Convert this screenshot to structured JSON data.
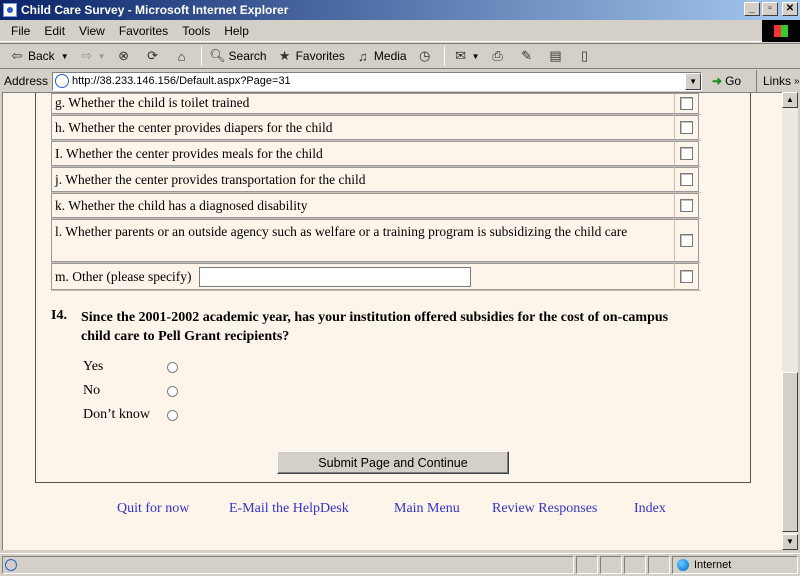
{
  "window": {
    "title": "Child Care Survey - Microsoft Internet Explorer",
    "minimize": "_",
    "maximize": "▫",
    "close": "✕"
  },
  "menu": [
    "File",
    "Edit",
    "View",
    "Favorites",
    "Tools",
    "Help"
  ],
  "toolbar": {
    "back": "Back",
    "search": "Search",
    "favorites": "Favorites",
    "media": "Media"
  },
  "address": {
    "label": "Address",
    "url": "http://38.233.146.156/Default.aspx?Page=31",
    "go": "Go",
    "links": "Links"
  },
  "options": [
    {
      "text": "g.  Whether the child is toilet trained",
      "checked": false
    },
    {
      "text": "h.  Whether the center provides diapers for the child",
      "checked": false
    },
    {
      "text": "I.  Whether the center provides meals for the child",
      "checked": false
    },
    {
      "text": "j.  Whether the center provides transportation for the child",
      "checked": false
    },
    {
      "text": "k.  Whether the child has a diagnosed disability",
      "checked": false
    },
    {
      "text": "l.  Whether parents or an outside agency such as welfare or a training program is subsidizing the child care",
      "checked": false
    },
    {
      "text": "m.  Other (please specify)",
      "checked": false,
      "specify_value": ""
    }
  ],
  "question": {
    "number": "I4.",
    "text": "Since the 2001-2002 academic year, has your institution offered subsidies for the cost of on-campus child care to Pell Grant recipients?",
    "answers": [
      "Yes",
      "No",
      "Don’t know"
    ]
  },
  "submit_label": "Submit Page and Continue",
  "footer_links": [
    "Quit for now",
    "E-Mail the HelpDesk",
    "Main Menu",
    "Review Responses",
    "Index"
  ],
  "status": {
    "zone": "Internet"
  },
  "colors": {
    "page_bg": "#fdf4ea",
    "link": "#3333cc",
    "chrome": "#d4d0c8",
    "titlebar": "#0a246a"
  }
}
